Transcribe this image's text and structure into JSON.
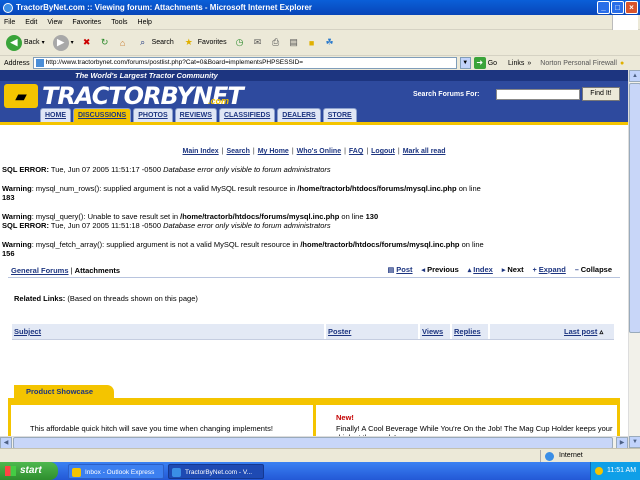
{
  "window": {
    "title": "TractorByNet.com :: Viewing forum: Attachments - Microsoft Internet Explorer",
    "minimize": "_",
    "maximize": "□",
    "close": "×"
  },
  "menubar": [
    "File",
    "Edit",
    "View",
    "Favorites",
    "Tools",
    "Help"
  ],
  "toolbar": {
    "back": "Back",
    "search": "Search",
    "favorites": "Favorites"
  },
  "addressbar": {
    "label": "Address",
    "url": "http://www.tractorbynet.com/forums/postlist.php?Cat=0&Board=implementsPHPSESSID=",
    "go": "Go",
    "links": "Links",
    "norton": "Norton Personal Firewall"
  },
  "site": {
    "tagline": "The World's Largest Tractor Community",
    "logo": "TRACTORBYNET",
    "logo_com": ".com",
    "search_label": "Search Forums For:",
    "search_value": "",
    "find_button": "Find It!",
    "nav": [
      "HOME",
      "DISCUSSIONS",
      "PHOTOS",
      "REVIEWS",
      "CLASSIFIEDS",
      "DEALERS",
      "STORE"
    ]
  },
  "toplinks": [
    "Main Index",
    "Search",
    "My Home",
    "Who's Online",
    "FAQ",
    "Logout",
    "Mark all read"
  ],
  "messages": {
    "err1_label": "SQL ERROR:",
    "err1_time": "Tue, Jun 07 2005 11:51:17 -0500",
    "err1_note": "Database error only visible to forum administrators",
    "warn1_label": "Warning",
    "warn1_text": ": mysql_num_rows(): supplied argument is not a valid MySQL result resource in",
    "warn1_path": "/home/tractorb/htdocs/forums/mysql.inc.php",
    "warn1_line_text": "on line",
    "warn1_line": "183",
    "warn2_label": "Warning",
    "warn2_text": ": mysql_query(): Unable to save result set in",
    "warn2_path": "/home/tractorb/htdocs/forums/mysql.inc.php",
    "warn2_line_text": "on line",
    "warn2_line": "130",
    "err2_label": "SQL ERROR:",
    "err2_time": "Tue, Jun 07 2005 11:51:18 -0500",
    "err2_note": "Database error only visible to forum administrators",
    "warn3_label": "Warning",
    "warn3_text": ": mysql_fetch_array(): supplied argument is not a valid MySQL result resource in",
    "warn3_path": "/home/tractorb/htdocs/forums/mysql.inc.php",
    "warn3_line_text": "on line",
    "warn3_line": "156"
  },
  "breadcrumb": {
    "forum": "General Forums",
    "sep": "|",
    "current": "Attachments"
  },
  "threadnav": {
    "post": "Post",
    "previous": "Previous",
    "index": "Index",
    "next": "Next",
    "expand": "Expand",
    "collapse": "Collapse"
  },
  "related": {
    "label": "Related Links:",
    "note": "(Based on threads shown on this page)"
  },
  "table": {
    "columns": [
      "Subject",
      "Poster",
      "Views",
      "Replies",
      "Last post"
    ],
    "sort_indicator": "▵"
  },
  "showcase": {
    "tab": "Product Showcase",
    "left_text": "This affordable quick hitch will save you time when changing implements!",
    "new_label": "New!",
    "right_text": "Finally! A Cool Beverage While You're On the Job! The Mag Cup Holder keeps your drink at the ready!"
  },
  "status": {
    "zone": "Internet"
  },
  "taskbar": {
    "start": "start",
    "items": [
      "Inbox - Outlook Express",
      "TractorByNet.com - V..."
    ],
    "clock": "11:51 AM"
  },
  "colors": {
    "site_blue": "#2e4a9e",
    "site_yellow": "#f4c400",
    "link_blue": "#1d3580"
  }
}
